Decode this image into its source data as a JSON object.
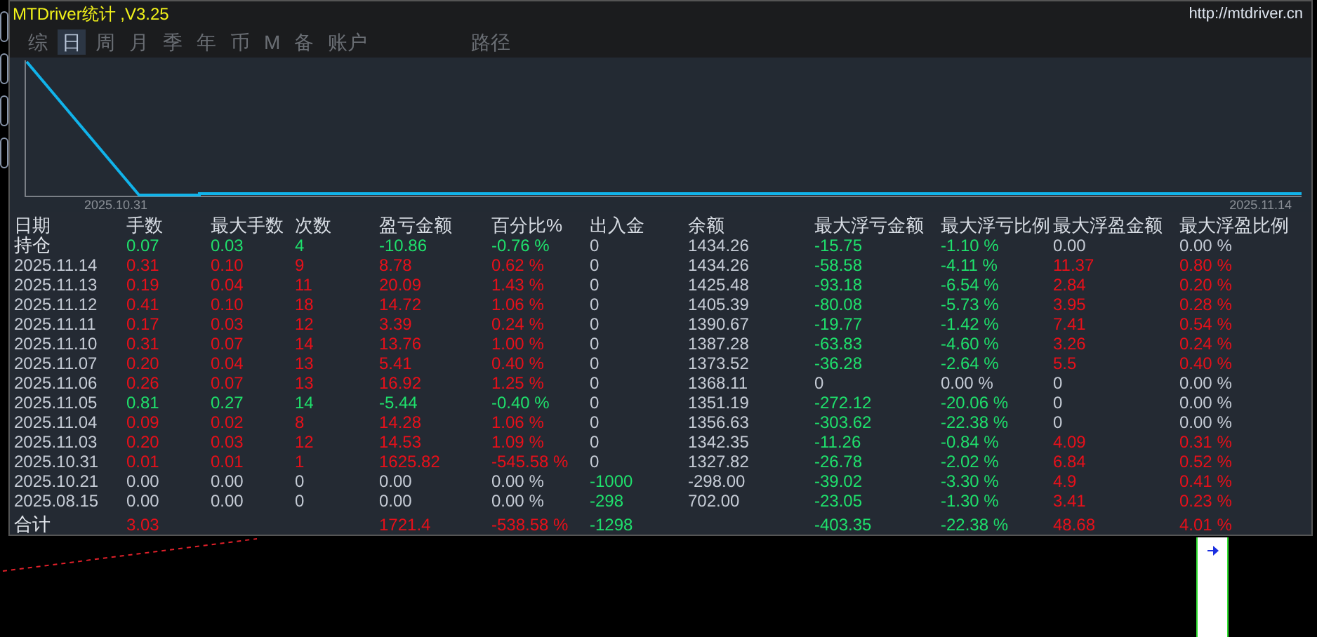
{
  "window": {
    "title": "MTDriver统计 ,V3.25",
    "link": "http://mtdriver.cn"
  },
  "tabs": [
    {
      "label": "综",
      "selected": false
    },
    {
      "label": "日",
      "selected": true
    },
    {
      "label": "周",
      "selected": false
    },
    {
      "label": "月",
      "selected": false
    },
    {
      "label": "季",
      "selected": false
    },
    {
      "label": "年",
      "selected": false
    },
    {
      "label": "币",
      "selected": false
    },
    {
      "label": "M",
      "selected": false
    },
    {
      "label": "备",
      "selected": false
    },
    {
      "label": "账户",
      "selected": false
    },
    {
      "label": "路径",
      "selected": false
    }
  ],
  "chart": {
    "x_labels": [
      "2025.10.31",
      "2025.11.14"
    ]
  },
  "table": {
    "columns": [
      "日期",
      "手数",
      "最大手数",
      "次数",
      "盈亏金额",
      "百分比%",
      "出入金",
      "余额",
      "最大浮亏金额",
      "最大浮亏比例",
      "最大浮盈金额",
      "最大浮盈比例"
    ],
    "rows": [
      {
        "cells": [
          {
            "text": "持仓",
            "color": "#e4e8ee"
          },
          {
            "text": "0.07",
            "color": "#1fe06c"
          },
          {
            "text": "0.03",
            "color": "#1fe06c"
          },
          {
            "text": "4",
            "color": "#1fe06c"
          },
          {
            "text": "-10.86",
            "color": "#1fe06c"
          },
          {
            "text": "-0.76 %",
            "color": "#1fe06c"
          },
          {
            "text": "0",
            "color": "#c6ccd6"
          },
          {
            "text": "1434.26",
            "color": "#c6ccd6"
          },
          {
            "text": "-15.75",
            "color": "#1fe06c"
          },
          {
            "text": "-1.10 %",
            "color": "#1fe06c"
          },
          {
            "text": "0.00",
            "color": "#c6ccd6"
          },
          {
            "text": "0.00 %",
            "color": "#c6ccd6"
          }
        ]
      },
      {
        "cells": [
          {
            "text": "2025.11.14",
            "color": "#c6ccd6"
          },
          {
            "text": "0.31",
            "color": "#e8101a"
          },
          {
            "text": "0.10",
            "color": "#e8101a"
          },
          {
            "text": "9",
            "color": "#e8101a"
          },
          {
            "text": "8.78",
            "color": "#e8101a"
          },
          {
            "text": "0.62 %",
            "color": "#e8101a"
          },
          {
            "text": "0",
            "color": "#c6ccd6"
          },
          {
            "text": "1434.26",
            "color": "#c6ccd6"
          },
          {
            "text": "-58.58",
            "color": "#1fe06c"
          },
          {
            "text": "-4.11 %",
            "color": "#1fe06c"
          },
          {
            "text": "11.37",
            "color": "#e8101a"
          },
          {
            "text": "0.80 %",
            "color": "#e8101a"
          }
        ]
      },
      {
        "cells": [
          {
            "text": "2025.11.13",
            "color": "#c6ccd6"
          },
          {
            "text": "0.19",
            "color": "#e8101a"
          },
          {
            "text": "0.04",
            "color": "#e8101a"
          },
          {
            "text": "11",
            "color": "#e8101a"
          },
          {
            "text": "20.09",
            "color": "#e8101a"
          },
          {
            "text": "1.43 %",
            "color": "#e8101a"
          },
          {
            "text": "0",
            "color": "#c6ccd6"
          },
          {
            "text": "1425.48",
            "color": "#c6ccd6"
          },
          {
            "text": "-93.18",
            "color": "#1fe06c"
          },
          {
            "text": "-6.54 %",
            "color": "#1fe06c"
          },
          {
            "text": "2.84",
            "color": "#e8101a"
          },
          {
            "text": "0.20 %",
            "color": "#e8101a"
          }
        ]
      },
      {
        "cells": [
          {
            "text": "2025.11.12",
            "color": "#c6ccd6"
          },
          {
            "text": "0.41",
            "color": "#e8101a"
          },
          {
            "text": "0.10",
            "color": "#e8101a"
          },
          {
            "text": "18",
            "color": "#e8101a"
          },
          {
            "text": "14.72",
            "color": "#e8101a"
          },
          {
            "text": "1.06 %",
            "color": "#e8101a"
          },
          {
            "text": "0",
            "color": "#c6ccd6"
          },
          {
            "text": "1405.39",
            "color": "#c6ccd6"
          },
          {
            "text": "-80.08",
            "color": "#1fe06c"
          },
          {
            "text": "-5.73 %",
            "color": "#1fe06c"
          },
          {
            "text": "3.95",
            "color": "#e8101a"
          },
          {
            "text": "0.28 %",
            "color": "#e8101a"
          }
        ]
      },
      {
        "cells": [
          {
            "text": "2025.11.11",
            "color": "#c6ccd6"
          },
          {
            "text": "0.17",
            "color": "#e8101a"
          },
          {
            "text": "0.03",
            "color": "#e8101a"
          },
          {
            "text": "12",
            "color": "#e8101a"
          },
          {
            "text": "3.39",
            "color": "#e8101a"
          },
          {
            "text": "0.24 %",
            "color": "#e8101a"
          },
          {
            "text": "0",
            "color": "#c6ccd6"
          },
          {
            "text": "1390.67",
            "color": "#c6ccd6"
          },
          {
            "text": "-19.77",
            "color": "#1fe06c"
          },
          {
            "text": "-1.42 %",
            "color": "#1fe06c"
          },
          {
            "text": "7.41",
            "color": "#e8101a"
          },
          {
            "text": "0.54 %",
            "color": "#e8101a"
          }
        ]
      },
      {
        "cells": [
          {
            "text": "2025.11.10",
            "color": "#c6ccd6"
          },
          {
            "text": "0.31",
            "color": "#e8101a"
          },
          {
            "text": "0.07",
            "color": "#e8101a"
          },
          {
            "text": "14",
            "color": "#e8101a"
          },
          {
            "text": "13.76",
            "color": "#e8101a"
          },
          {
            "text": "1.00 %",
            "color": "#e8101a"
          },
          {
            "text": "0",
            "color": "#c6ccd6"
          },
          {
            "text": "1387.28",
            "color": "#c6ccd6"
          },
          {
            "text": "-63.83",
            "color": "#1fe06c"
          },
          {
            "text": "-4.60 %",
            "color": "#1fe06c"
          },
          {
            "text": "3.26",
            "color": "#e8101a"
          },
          {
            "text": "0.24 %",
            "color": "#e8101a"
          }
        ]
      },
      {
        "cells": [
          {
            "text": "2025.11.07",
            "color": "#c6ccd6"
          },
          {
            "text": "0.20",
            "color": "#e8101a"
          },
          {
            "text": "0.04",
            "color": "#e8101a"
          },
          {
            "text": "13",
            "color": "#e8101a"
          },
          {
            "text": "5.41",
            "color": "#e8101a"
          },
          {
            "text": "0.40 %",
            "color": "#e8101a"
          },
          {
            "text": "0",
            "color": "#c6ccd6"
          },
          {
            "text": "1373.52",
            "color": "#c6ccd6"
          },
          {
            "text": "-36.28",
            "color": "#1fe06c"
          },
          {
            "text": "-2.64 %",
            "color": "#1fe06c"
          },
          {
            "text": "5.5",
            "color": "#e8101a"
          },
          {
            "text": "0.40 %",
            "color": "#e8101a"
          }
        ]
      },
      {
        "cells": [
          {
            "text": "2025.11.06",
            "color": "#c6ccd6"
          },
          {
            "text": "0.26",
            "color": "#e8101a"
          },
          {
            "text": "0.07",
            "color": "#e8101a"
          },
          {
            "text": "13",
            "color": "#e8101a"
          },
          {
            "text": "16.92",
            "color": "#e8101a"
          },
          {
            "text": "1.25 %",
            "color": "#e8101a"
          },
          {
            "text": "0",
            "color": "#c6ccd6"
          },
          {
            "text": "1368.11",
            "color": "#c6ccd6"
          },
          {
            "text": "0",
            "color": "#c6ccd6"
          },
          {
            "text": "0.00 %",
            "color": "#c6ccd6"
          },
          {
            "text": "0",
            "color": "#c6ccd6"
          },
          {
            "text": "0.00 %",
            "color": "#c6ccd6"
          }
        ]
      },
      {
        "cells": [
          {
            "text": "2025.11.05",
            "color": "#c6ccd6"
          },
          {
            "text": "0.81",
            "color": "#1fe06c"
          },
          {
            "text": "0.27",
            "color": "#1fe06c"
          },
          {
            "text": "14",
            "color": "#1fe06c"
          },
          {
            "text": "-5.44",
            "color": "#1fe06c"
          },
          {
            "text": "-0.40 %",
            "color": "#1fe06c"
          },
          {
            "text": "0",
            "color": "#c6ccd6"
          },
          {
            "text": "1351.19",
            "color": "#c6ccd6"
          },
          {
            "text": "-272.12",
            "color": "#1fe06c"
          },
          {
            "text": "-20.06 %",
            "color": "#1fe06c"
          },
          {
            "text": "0",
            "color": "#c6ccd6"
          },
          {
            "text": "0.00 %",
            "color": "#c6ccd6"
          }
        ]
      },
      {
        "cells": [
          {
            "text": "2025.11.04",
            "color": "#c6ccd6"
          },
          {
            "text": "0.09",
            "color": "#e8101a"
          },
          {
            "text": "0.02",
            "color": "#e8101a"
          },
          {
            "text": "8",
            "color": "#e8101a"
          },
          {
            "text": "14.28",
            "color": "#e8101a"
          },
          {
            "text": "1.06 %",
            "color": "#e8101a"
          },
          {
            "text": "0",
            "color": "#c6ccd6"
          },
          {
            "text": "1356.63",
            "color": "#c6ccd6"
          },
          {
            "text": "-303.62",
            "color": "#1fe06c"
          },
          {
            "text": "-22.38 %",
            "color": "#1fe06c"
          },
          {
            "text": "0",
            "color": "#c6ccd6"
          },
          {
            "text": "0.00 %",
            "color": "#c6ccd6"
          }
        ]
      },
      {
        "cells": [
          {
            "text": "2025.11.03",
            "color": "#c6ccd6"
          },
          {
            "text": "0.20",
            "color": "#e8101a"
          },
          {
            "text": "0.03",
            "color": "#e8101a"
          },
          {
            "text": "12",
            "color": "#e8101a"
          },
          {
            "text": "14.53",
            "color": "#e8101a"
          },
          {
            "text": "1.09 %",
            "color": "#e8101a"
          },
          {
            "text": "0",
            "color": "#c6ccd6"
          },
          {
            "text": "1342.35",
            "color": "#c6ccd6"
          },
          {
            "text": "-11.26",
            "color": "#1fe06c"
          },
          {
            "text": "-0.84 %",
            "color": "#1fe06c"
          },
          {
            "text": "4.09",
            "color": "#e8101a"
          },
          {
            "text": "0.31 %",
            "color": "#e8101a"
          }
        ]
      },
      {
        "cells": [
          {
            "text": "2025.10.31",
            "color": "#c6ccd6"
          },
          {
            "text": "0.01",
            "color": "#e8101a"
          },
          {
            "text": "0.01",
            "color": "#e8101a"
          },
          {
            "text": "1",
            "color": "#e8101a"
          },
          {
            "text": "1625.82",
            "color": "#e8101a"
          },
          {
            "text": "-545.58 %",
            "color": "#e8101a"
          },
          {
            "text": "0",
            "color": "#c6ccd6"
          },
          {
            "text": "1327.82",
            "color": "#c6ccd6"
          },
          {
            "text": "-26.78",
            "color": "#1fe06c"
          },
          {
            "text": "-2.02 %",
            "color": "#1fe06c"
          },
          {
            "text": "6.84",
            "color": "#e8101a"
          },
          {
            "text": "0.52 %",
            "color": "#e8101a"
          }
        ]
      },
      {
        "cells": [
          {
            "text": "2025.10.21",
            "color": "#c6ccd6"
          },
          {
            "text": "0.00",
            "color": "#c6ccd6"
          },
          {
            "text": "0.00",
            "color": "#c6ccd6"
          },
          {
            "text": "0",
            "color": "#c6ccd6"
          },
          {
            "text": "0.00",
            "color": "#c6ccd6"
          },
          {
            "text": "0.00 %",
            "color": "#c6ccd6"
          },
          {
            "text": "-1000",
            "color": "#1fe06c"
          },
          {
            "text": "-298.00",
            "color": "#c6ccd6"
          },
          {
            "text": "-39.02",
            "color": "#1fe06c"
          },
          {
            "text": "-3.30 %",
            "color": "#1fe06c"
          },
          {
            "text": "4.9",
            "color": "#e8101a"
          },
          {
            "text": "0.41 %",
            "color": "#e8101a"
          }
        ]
      },
      {
        "cells": [
          {
            "text": "2025.08.15",
            "color": "#c6ccd6"
          },
          {
            "text": "0.00",
            "color": "#c6ccd6"
          },
          {
            "text": "0.00",
            "color": "#c6ccd6"
          },
          {
            "text": "0",
            "color": "#c6ccd6"
          },
          {
            "text": "0.00",
            "color": "#c6ccd6"
          },
          {
            "text": "0.00 %",
            "color": "#c6ccd6"
          },
          {
            "text": "-298",
            "color": "#1fe06c"
          },
          {
            "text": "702.00",
            "color": "#c6ccd6"
          },
          {
            "text": "-23.05",
            "color": "#1fe06c"
          },
          {
            "text": "-1.30 %",
            "color": "#1fe06c"
          },
          {
            "text": "3.41",
            "color": "#e8101a"
          },
          {
            "text": "0.23 %",
            "color": "#e8101a"
          }
        ]
      }
    ],
    "total": {
      "label": {
        "text": "合计",
        "color": "#e4e8ee"
      },
      "lots": {
        "text": "3.03",
        "color": "#e8101a"
      },
      "profit": {
        "text": "1721.4",
        "color": "#e8101a"
      },
      "percent": {
        "text": "-538.58 %",
        "color": "#e8101a"
      },
      "deposit": {
        "text": "-1298",
        "color": "#1fe06c"
      },
      "max_float_loss": {
        "text": "-403.35",
        "color": "#1fe06c"
      },
      "max_float_loss_pct": {
        "text": "-22.38 %",
        "color": "#1fe06c"
      },
      "max_float_profit": {
        "text": "48.68",
        "color": "#e8101a"
      },
      "max_float_profit_pct": {
        "text": "4.01 %",
        "color": "#e8101a"
      }
    }
  }
}
